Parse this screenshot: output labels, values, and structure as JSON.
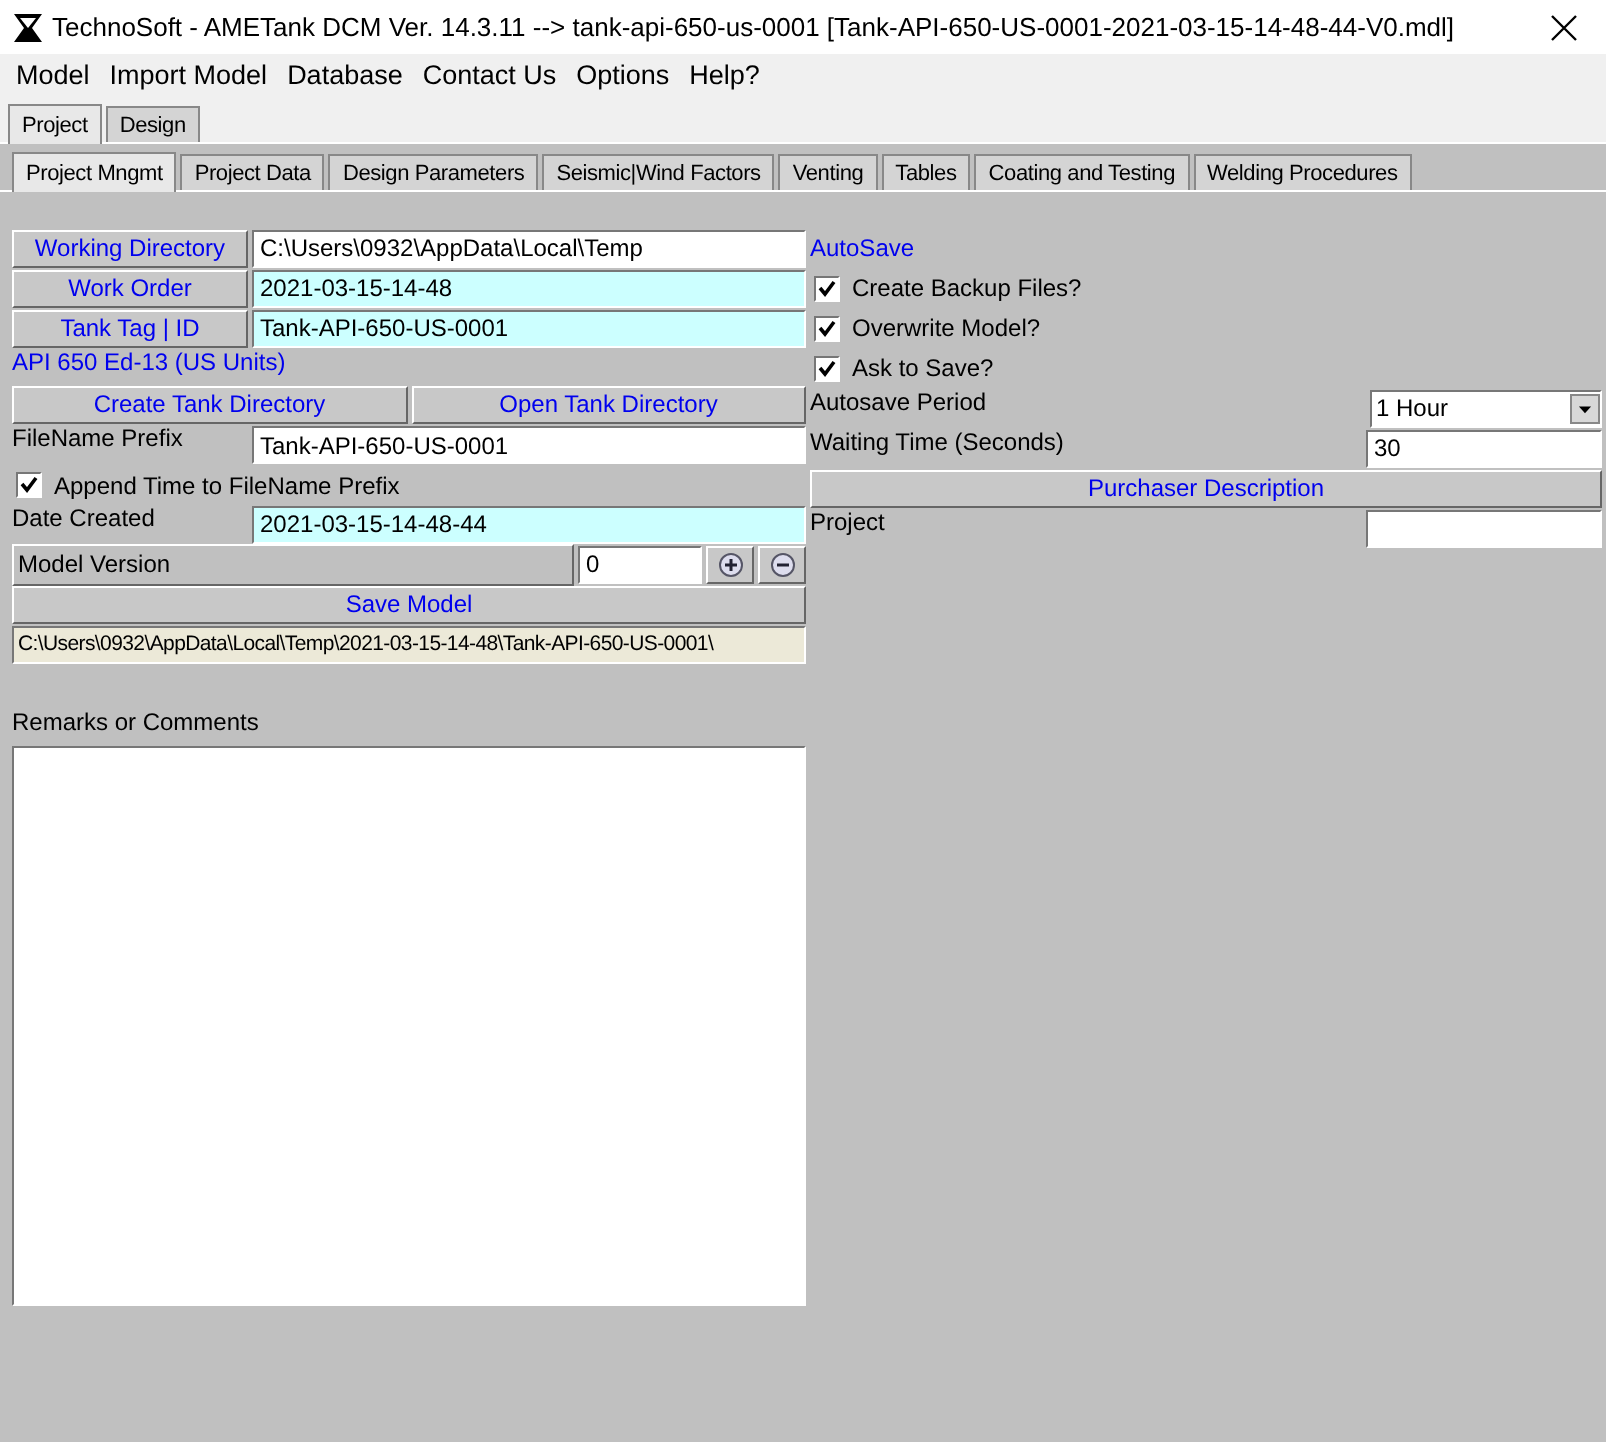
{
  "window": {
    "title": "TechnoSoft - AMETank DCM Ver. 14.3.11 --> tank-api-650-us-0001  [Tank-API-650-US-0001-2021-03-15-14-48-44-V0.mdl]"
  },
  "menu": [
    "Model",
    "Import Model",
    "Database",
    "Contact Us",
    "Options",
    "Help?"
  ],
  "outer_tabs": [
    {
      "label": "Project",
      "selected": true
    },
    {
      "label": "Design",
      "selected": false
    }
  ],
  "inner_tabs": [
    {
      "label": "Project Mngmt",
      "selected": true
    },
    {
      "label": "Project Data",
      "selected": false
    },
    {
      "label": "Design Parameters",
      "selected": false
    },
    {
      "label": "Seismic|Wind Factors",
      "selected": false
    },
    {
      "label": "Venting",
      "selected": false
    },
    {
      "label": "Tables",
      "selected": false
    },
    {
      "label": "Coating and Testing",
      "selected": false
    },
    {
      "label": "Welding Procedures",
      "selected": false
    }
  ],
  "left": {
    "directory_fields": [
      {
        "button": "Working Directory",
        "value": "C:\\Users\\0932\\AppData\\Local\\Temp",
        "readonly": false
      },
      {
        "button": "Work Order",
        "value": "2021-03-15-14-48",
        "readonly": true
      },
      {
        "button": "Tank Tag | ID",
        "value": "Tank-API-650-US-0001",
        "readonly": true
      }
    ],
    "code_label": "API 650 Ed-13 (US Units)",
    "directory_buttons": [
      "Create Tank Directory",
      "Open Tank Directory"
    ],
    "filename_prefix": {
      "label": "FileName Prefix",
      "value": "Tank-API-650-US-0001",
      "readonly": false
    },
    "append_time": {
      "label": "Append Time to FileName Prefix",
      "checked": true
    },
    "date_created": {
      "label": "Date Created",
      "value": "2021-03-15-14-48-44",
      "readonly": true
    },
    "model_version": {
      "label": "Model Version",
      "value": "0"
    },
    "save_button": "Save Model",
    "save_path": "C:\\Users\\0932\\AppData\\Local\\Temp\\2021-03-15-14-48\\Tank-API-650-US-0001\\",
    "remarks": {
      "label": "Remarks or Comments"
    }
  },
  "right": {
    "heading": "AutoSave",
    "options": [
      {
        "label": "Create Backup Files?",
        "checked": true
      },
      {
        "label": "Overwrite Model?",
        "checked": true
      },
      {
        "label": "Ask to Save?",
        "checked": true
      }
    ],
    "autosave_period": {
      "label": "Autosave Period",
      "value": "1 Hour"
    },
    "waiting_time": {
      "label": "Waiting Time (Seconds)",
      "value": "30"
    },
    "purchaser_button": "Purchaser Description",
    "project": {
      "label": "Project"
    }
  }
}
